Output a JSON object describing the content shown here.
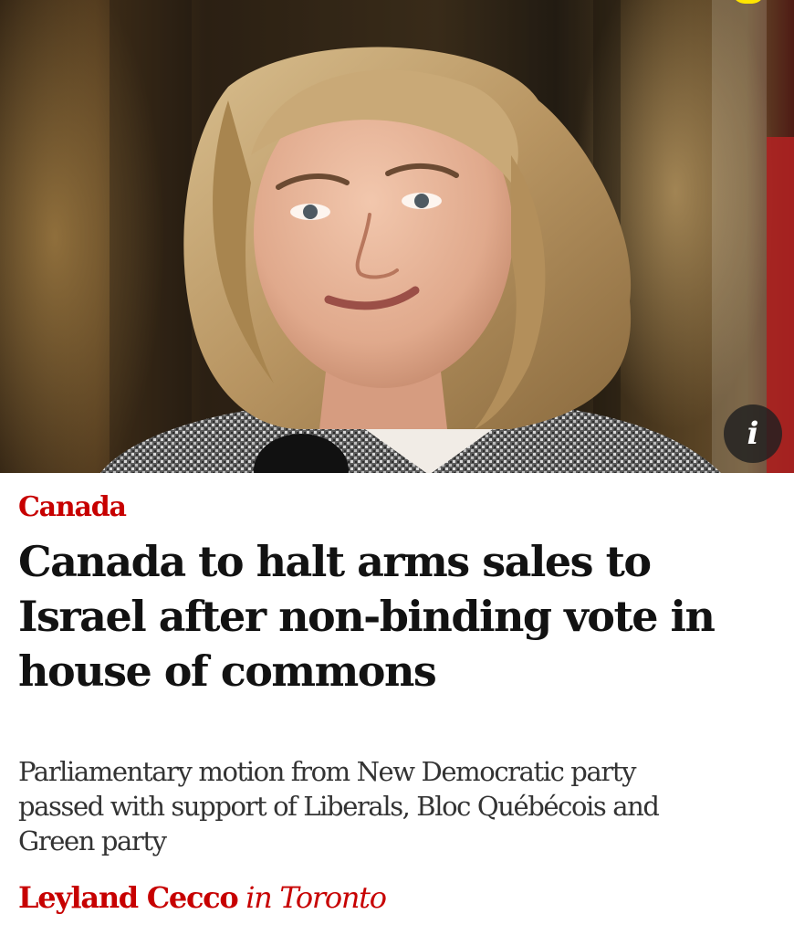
{
  "hero": {
    "image_description_icon": "person-photo",
    "info_button_label": "i",
    "info_icon": "info-icon"
  },
  "article": {
    "section": "Canada",
    "headline_lines": [
      "Canada to halt arms sales to",
      "Israel after non-binding vote in",
      "house of commons"
    ],
    "standfirst_lines": [
      "Parliamentary motion from New Democratic party",
      "passed with support of Liberals, Bloc Québécois and",
      "Green party"
    ],
    "byline": {
      "author": "Leyland Cecco",
      "location": "in Toronto"
    }
  },
  "colors": {
    "accent_red": "#c70000",
    "headline_text": "#121212",
    "standfirst_text": "#333333",
    "corner_badge": "#ffe500"
  }
}
